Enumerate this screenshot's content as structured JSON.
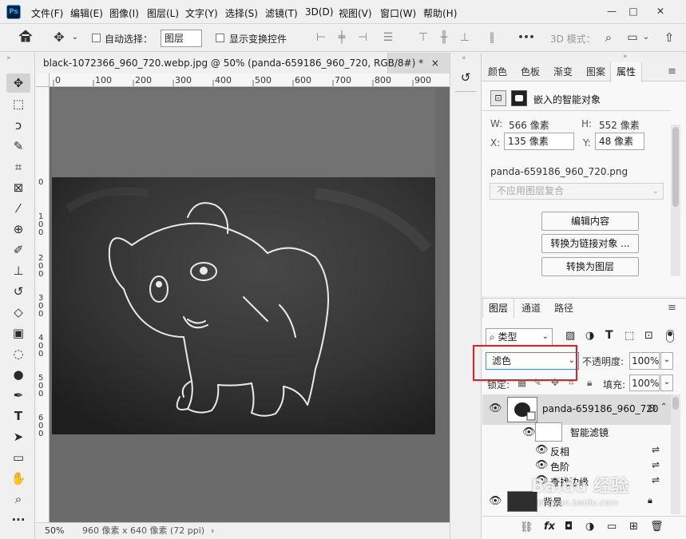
{
  "app": {
    "logo": "Ps",
    "menu": [
      "文件(F)",
      "编辑(E)",
      "图像(I)",
      "图层(L)",
      "文字(Y)",
      "选择(S)",
      "滤镜(T)",
      "3D(D)",
      "视图(V)",
      "窗口(W)",
      "帮助(H)"
    ],
    "window_buttons": {
      "minimize": "—",
      "maximize": "□",
      "close": "✕"
    }
  },
  "options_bar": {
    "auto_select_label": "自动选择：",
    "auto_select_value": "图层",
    "show_transform_label": "显示变换控件",
    "mode_3d_label": "3D 模式：",
    "more_label": "•••"
  },
  "document": {
    "tab_title": "black-1072366_960_720.webp.jpg @ 50% (panda-659186_960_720, RGB/8#) *",
    "tab_close": "×",
    "ruler_h": [
      "0",
      "100",
      "200",
      "300",
      "400",
      "500",
      "600",
      "700",
      "800",
      "900"
    ],
    "ruler_v": [
      "0",
      "100",
      "200",
      "300",
      "400",
      "500",
      "600"
    ],
    "zoom": "50%",
    "doc_info": "960 像素 x 640 像素 (72 ppi)",
    "status_arrow": "›"
  },
  "properties_panel": {
    "tabs": [
      "颜色",
      "色板",
      "渐变",
      "图案",
      "属性"
    ],
    "active_tab": "属性",
    "menu_icon": "≡",
    "object_type": "嵌入的智能对象",
    "w_label": "W:",
    "w_value": "566 像素",
    "h_label": "H:",
    "h_value": "552 像素",
    "x_label": "X:",
    "x_value": "135 像素",
    "y_label": "Y:",
    "y_value": "48 像素",
    "filename": "panda-659186_960_720.png",
    "comp_placeholder": "不应用图层复合",
    "btn_edit": "编辑内容",
    "btn_link": "转换为链接对象 ...",
    "btn_layer": "转换为图层"
  },
  "layers_panel": {
    "tabs": [
      "图层",
      "通道",
      "路径"
    ],
    "active_tab": "图层",
    "filter_kind": "类型",
    "blend_mode": "滤色",
    "opacity_label": "不透明度:",
    "opacity_value": "100%",
    "lock_label": "锁定:",
    "fill_label": "填充:",
    "fill_value": "100%",
    "layers": [
      {
        "name": "panda-659186_960_720"
      },
      {
        "name": "智能滤镜"
      },
      {
        "name": "反相"
      },
      {
        "name": "色阶"
      },
      {
        "name": "查找边缘"
      },
      {
        "name": "背景"
      }
    ],
    "footer_icons": [
      "link-icon",
      "fx-icon",
      "mask-icon",
      "adjustment-icon",
      "group-icon",
      "new-layer-icon",
      "trash-icon"
    ]
  },
  "watermark": {
    "text": "Baidu 经验",
    "url": "jingyan.baidu.com"
  },
  "colors": {
    "highlight": "#e02020",
    "canvas": "#6a6a6a",
    "panel": "#f0f0f0"
  }
}
